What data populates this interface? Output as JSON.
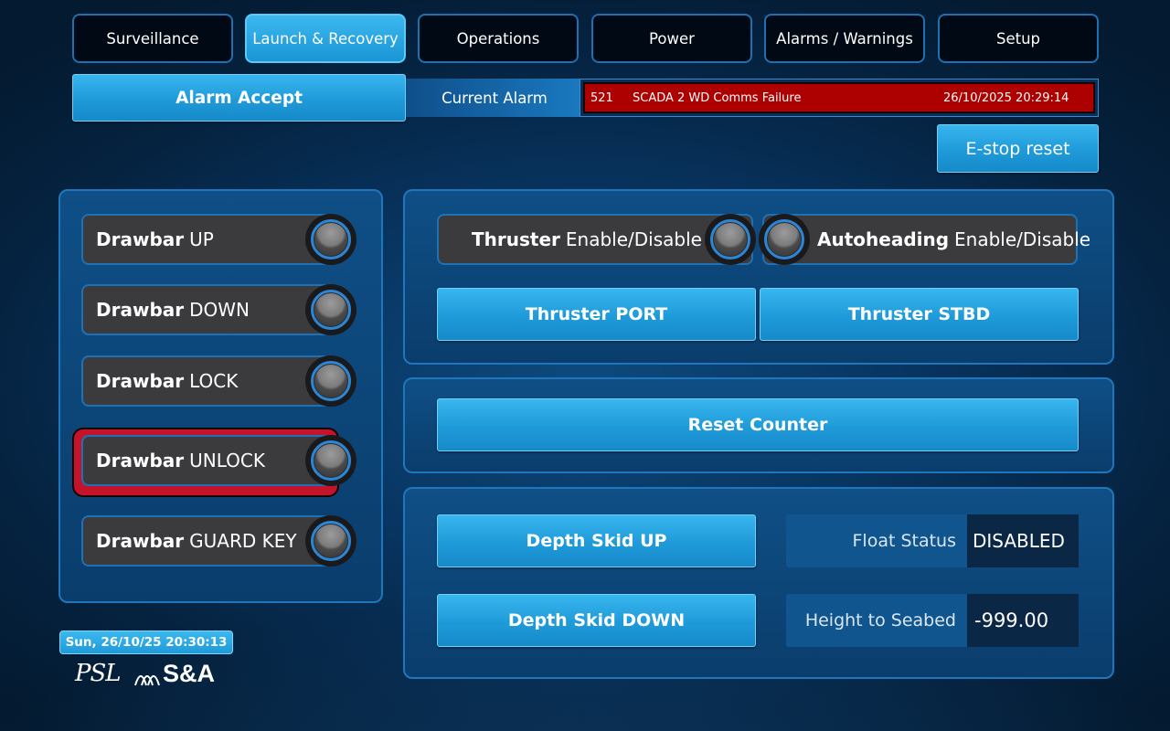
{
  "tabs": [
    {
      "label": "Surveillance",
      "active": false
    },
    {
      "label": "Launch & Recovery",
      "active": true
    },
    {
      "label": "Operations",
      "active": false
    },
    {
      "label": "Power",
      "active": false
    },
    {
      "label": "Alarms / Warnings",
      "active": false
    },
    {
      "label": "Setup",
      "active": false
    }
  ],
  "alarm": {
    "accept_label": "Alarm Accept",
    "current_label": "Current Alarm",
    "code": "521",
    "message": "SCADA 2 WD Comms Failure",
    "timestamp": "26/10/2025 20:29:14"
  },
  "estop_label": "E-stop reset",
  "drawbar": [
    {
      "prefix": "Drawbar",
      "suffix": "UP",
      "alarmed": false
    },
    {
      "prefix": "Drawbar",
      "suffix": "DOWN",
      "alarmed": false
    },
    {
      "prefix": "Drawbar",
      "suffix": "LOCK",
      "alarmed": false
    },
    {
      "prefix": "Drawbar",
      "suffix": "UNLOCK",
      "alarmed": true
    },
    {
      "prefix": "Drawbar",
      "suffix": "GUARD KEY",
      "alarmed": false
    }
  ],
  "thruster": {
    "enable_prefix": "Thruster",
    "enable_suffix": "Enable/Disable",
    "autoheading_prefix": "Autoheading",
    "autoheading_suffix": "Enable/Disable",
    "port_label": "Thruster PORT",
    "stbd_label": "Thruster STBD"
  },
  "reset_counter_label": "Reset Counter",
  "depth_skid": {
    "up_label": "Depth Skid UP",
    "down_label": "Depth Skid DOWN",
    "float_status_label": "Float Status",
    "float_status_value": "DISABLED",
    "height_label": "Height to Seabed",
    "height_value": "-999.00"
  },
  "datetime": "Sun, 26/10/25 20:30:13",
  "logo": {
    "left": "PSL",
    "right": "S&A"
  },
  "colors": {
    "accent": "#1f9ad9",
    "alarm_red": "#ad0000",
    "panel_border": "#1e76bc",
    "lamp_ring": "#2c86d6"
  }
}
